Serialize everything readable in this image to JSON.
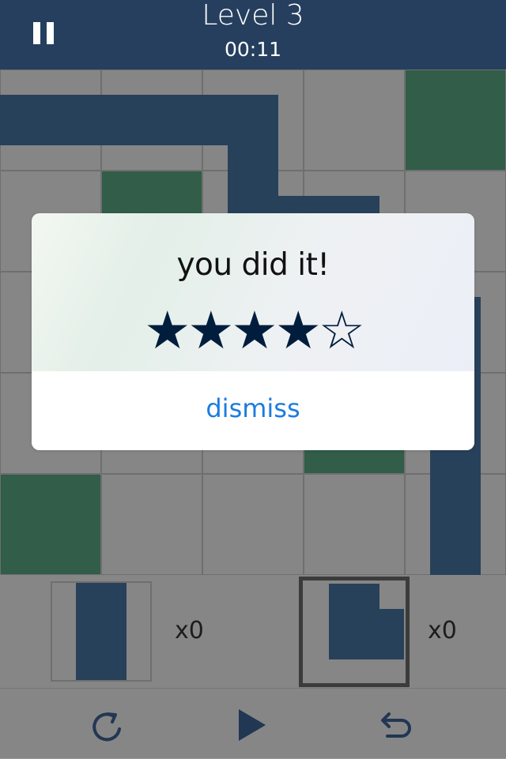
{
  "header": {
    "title": "Level 3",
    "timer": "00:11"
  },
  "dialog": {
    "message": "you did it!",
    "stars": "★★★★☆",
    "rating": {
      "filled": 4,
      "total": 5
    },
    "dismiss_label": "dismiss"
  },
  "tray": {
    "piece_counts": [
      "x0",
      "x0"
    ]
  },
  "colors": {
    "header": "#263f5e",
    "pipe": "#2e4a68",
    "green_tile": "#386a54",
    "accent": "#1c7ce0",
    "stars": "#001d3d"
  },
  "icons": [
    "pause-icon",
    "rotate-icon",
    "play-icon",
    "undo-icon"
  ]
}
